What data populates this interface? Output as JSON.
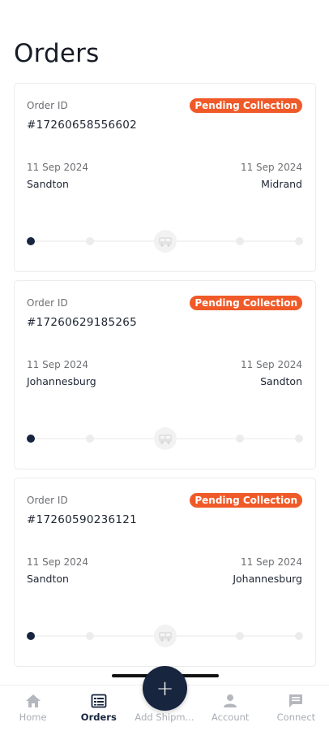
{
  "page": {
    "title": "Orders"
  },
  "colors": {
    "accent": "#17253f",
    "status": "#f05a28"
  },
  "orders": [
    {
      "id_label": "Order ID",
      "status": "Pending Collection",
      "number": "#17260658556602",
      "from_date": "11 Sep 2024",
      "to_date": "11 Sep 2024",
      "from": "Sandton",
      "to": "Midrand",
      "progress_step": 1
    },
    {
      "id_label": "Order ID",
      "status": "Pending Collection",
      "number": "#17260629185265",
      "from_date": "11 Sep 2024",
      "to_date": "11 Sep 2024",
      "from": "Johannesburg",
      "to": "Sandton",
      "progress_step": 1
    },
    {
      "id_label": "Order ID",
      "status": "Pending Collection",
      "number": "#17260590236121",
      "from_date": "11 Sep 2024",
      "to_date": "11 Sep 2024",
      "from": "Sandton",
      "to": "Johannesburg",
      "progress_step": 1
    }
  ],
  "fab": {
    "label": "+"
  },
  "nav": [
    {
      "label": "Home",
      "icon": "home-icon",
      "active": false
    },
    {
      "label": "Orders",
      "icon": "orders-icon",
      "active": true
    },
    {
      "label": "Add Shipm...",
      "icon": "add-shipment-icon",
      "active": false
    },
    {
      "label": "Account",
      "icon": "account-icon",
      "active": false
    },
    {
      "label": "Connect",
      "icon": "chat-icon",
      "active": false
    }
  ]
}
